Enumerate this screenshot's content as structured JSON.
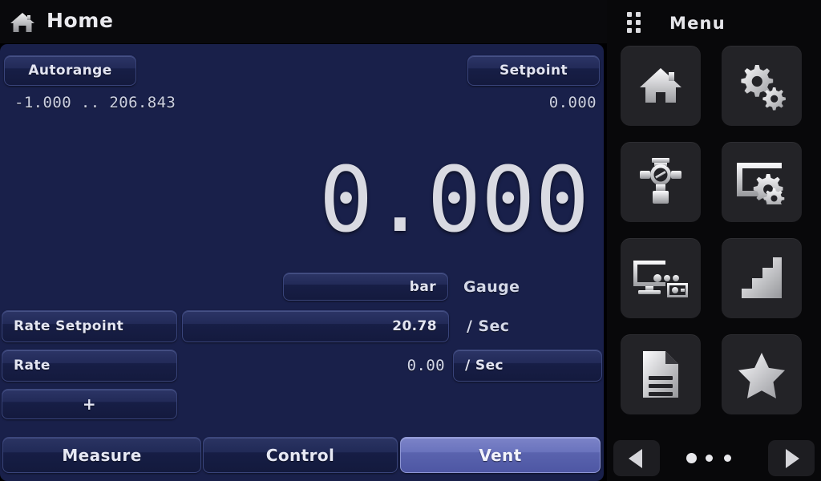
{
  "header": {
    "home_icon": "home-icon",
    "title": "Home"
  },
  "panel": {
    "autorange_label": "Autorange",
    "setpoint_label": "Setpoint",
    "range_text": "-1.000 .. 206.843",
    "setpoint_value": "0.000",
    "reading": "0.000",
    "units_label": "bar",
    "mode_label": "Gauge",
    "rate_setpoint_label": "Rate Setpoint",
    "rate_setpoint_value": "20.78",
    "rate_setpoint_unit": "/ Sec",
    "rate_label": "Rate",
    "rate_value": "0.00",
    "rate_unit": "/ Sec",
    "add_label": "+"
  },
  "tabs": [
    {
      "label": "Measure",
      "active": false
    },
    {
      "label": "Control",
      "active": false
    },
    {
      "label": "Vent",
      "active": true
    }
  ],
  "sidebar": {
    "grid_icon": "grid-dots-icon",
    "menu_label": "Menu",
    "tiles": [
      {
        "icon": "home-icon",
        "name": "tile-home"
      },
      {
        "icon": "gears-icon",
        "name": "tile-settings"
      },
      {
        "icon": "pressure-regulator-icon",
        "name": "tile-regulator"
      },
      {
        "icon": "display-settings-icon",
        "name": "tile-display-settings"
      },
      {
        "icon": "remote-devices-icon",
        "name": "tile-remote"
      },
      {
        "icon": "steps-icon",
        "name": "tile-steps"
      },
      {
        "icon": "document-icon",
        "name": "tile-document"
      },
      {
        "icon": "star-icon",
        "name": "tile-favorites"
      }
    ],
    "nav_prev_icon": "triangle-left-icon",
    "nav_next_icon": "triangle-right-icon",
    "page_dots": [
      true,
      false,
      false
    ]
  },
  "colors": {
    "panel_bg": "#19204a",
    "accent_active": "#6a73bd",
    "sidebar_bg": "#08080a",
    "tile_bg": "#232327",
    "text_primary": "#e3e5f2"
  }
}
